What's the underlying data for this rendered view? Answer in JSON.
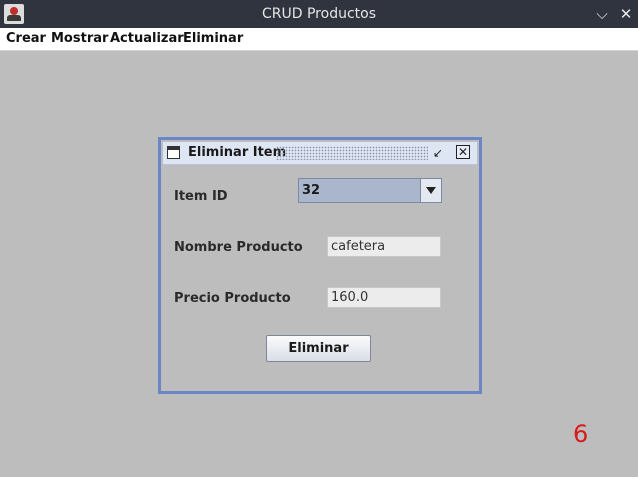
{
  "window": {
    "title": "CRUD Productos",
    "app_icon": "java-icon",
    "controls": [
      "chevron-down-icon",
      "close-icon"
    ]
  },
  "menubar": {
    "items": [
      "Crear",
      "Mostrar",
      "Actualizar",
      "Eliminar"
    ]
  },
  "internal_frame": {
    "title": "Eliminar Item",
    "icon": "window-icon",
    "controls": [
      "restore-icon",
      "close-icon"
    ],
    "form": {
      "item_id_label": "Item ID",
      "item_id_value": "32",
      "nombre_label": "Nombre Producto",
      "nombre_value": "cafetera",
      "precio_label": "Precio Producto",
      "precio_value": "160.0",
      "submit_label": "Eliminar"
    }
  },
  "overlay": {
    "counter": "6",
    "counter_color": "#d61b1b"
  },
  "colors": {
    "titlebar": "#2f343f",
    "desktop": "#bdbdbd",
    "frame_border": "#6b86c4"
  }
}
